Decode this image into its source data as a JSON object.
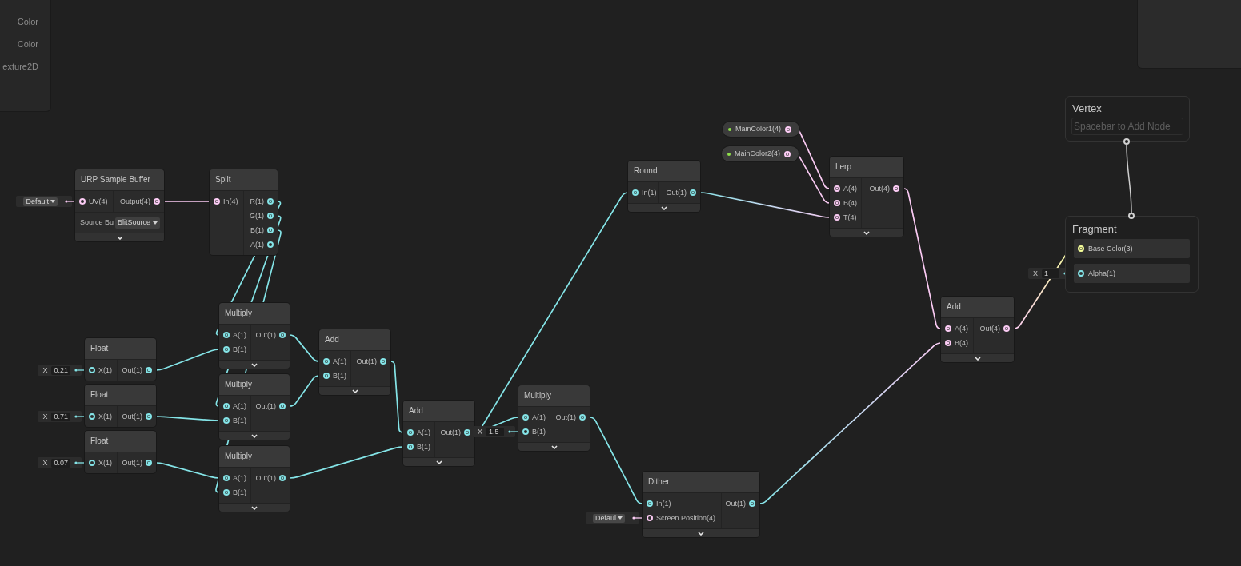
{
  "blackboard": {
    "rows": [
      {
        "type": "Color"
      },
      {
        "type": "Color"
      },
      {
        "type": "exture2D"
      }
    ]
  },
  "nodes": [
    {
      "title": "URP Sample Buffer",
      "inputs": [
        {
          "label": "UV(4)",
          "color": "#fbcbf4",
          "connected": false,
          "inline": {
            "kind": "dropdown",
            "value": "Default"
          }
        }
      ],
      "outputs": [
        {
          "label": "Output(4)",
          "color": "#fbcbf4",
          "connected": true
        }
      ],
      "settings": [
        {
          "label": "Source Bu",
          "value": "BlitSource"
        }
      ],
      "collapsed": true
    },
    {
      "title": "Split",
      "inputs": [
        {
          "label": "In(4)",
          "color": "#fbcbf4",
          "connected": true
        }
      ],
      "outputs": [
        {
          "label": "R(1)",
          "color": "#84e4e7",
          "connected": true
        },
        {
          "label": "G(1)",
          "color": "#84e4e7",
          "connected": true
        },
        {
          "label": "B(1)",
          "color": "#84e4e7",
          "connected": true
        },
        {
          "label": "A(1)",
          "color": "#84e4e7",
          "connected": false
        }
      ]
    },
    {
      "title": "Float",
      "inputs": [
        {
          "label": "X(1)",
          "color": "#84e4e7",
          "connected": false,
          "inline": {
            "kind": "float",
            "label": "X",
            "value": "0.21"
          }
        }
      ],
      "outputs": [
        {
          "label": "Out(1)",
          "color": "#84e4e7",
          "connected": true
        }
      ]
    },
    {
      "title": "Float",
      "inputs": [
        {
          "label": "X(1)",
          "color": "#84e4e7",
          "connected": false,
          "inline": {
            "kind": "float",
            "label": "X",
            "value": "0.71"
          }
        }
      ],
      "outputs": [
        {
          "label": "Out(1)",
          "color": "#84e4e7",
          "connected": true
        }
      ]
    },
    {
      "title": "Float",
      "inputs": [
        {
          "label": "X(1)",
          "color": "#84e4e7",
          "connected": false,
          "inline": {
            "kind": "float",
            "label": "X",
            "value": "0.07"
          }
        }
      ],
      "outputs": [
        {
          "label": "Out(1)",
          "color": "#84e4e7",
          "connected": true
        }
      ]
    },
    {
      "title": "Multiply",
      "inputs": [
        {
          "label": "A(1)",
          "color": "#84e4e7",
          "connected": true
        },
        {
          "label": "B(1)",
          "color": "#84e4e7",
          "connected": true
        }
      ],
      "outputs": [
        {
          "label": "Out(1)",
          "color": "#84e4e7",
          "connected": true
        }
      ],
      "collapsed": true
    },
    {
      "title": "Multiply",
      "inputs": [
        {
          "label": "A(1)",
          "color": "#84e4e7",
          "connected": true
        },
        {
          "label": "B(1)",
          "color": "#84e4e7",
          "connected": true
        }
      ],
      "outputs": [
        {
          "label": "Out(1)",
          "color": "#84e4e7",
          "connected": true
        }
      ],
      "collapsed": true
    },
    {
      "title": "Multiply",
      "inputs": [
        {
          "label": "A(1)",
          "color": "#84e4e7",
          "connected": true
        },
        {
          "label": "B(1)",
          "color": "#84e4e7",
          "connected": true
        }
      ],
      "outputs": [
        {
          "label": "Out(1)",
          "color": "#84e4e7",
          "connected": true
        }
      ],
      "collapsed": true
    },
    {
      "title": "Add",
      "inputs": [
        {
          "label": "A(1)",
          "color": "#84e4e7",
          "connected": true
        },
        {
          "label": "B(1)",
          "color": "#84e4e7",
          "connected": true
        }
      ],
      "outputs": [
        {
          "label": "Out(1)",
          "color": "#84e4e7",
          "connected": true
        }
      ],
      "collapsed": true
    },
    {
      "title": "Add",
      "inputs": [
        {
          "label": "A(1)",
          "color": "#84e4e7",
          "connected": true
        },
        {
          "label": "B(1)",
          "color": "#84e4e7",
          "connected": true
        }
      ],
      "outputs": [
        {
          "label": "Out(1)",
          "color": "#84e4e7",
          "connected": true
        }
      ],
      "collapsed": true
    },
    {
      "title": "Multiply",
      "inputs": [
        {
          "label": "A(1)",
          "color": "#84e4e7",
          "connected": true
        },
        {
          "label": "B(1)",
          "color": "#84e4e7",
          "connected": false,
          "inline": {
            "kind": "float",
            "label": "X",
            "value": "1.5"
          }
        }
      ],
      "outputs": [
        {
          "label": "Out(1)",
          "color": "#84e4e7",
          "connected": true
        }
      ],
      "collapsed": true
    },
    {
      "title": "Round",
      "inputs": [
        {
          "label": "In(1)",
          "color": "#84e4e7",
          "connected": true
        }
      ],
      "outputs": [
        {
          "label": "Out(1)",
          "color": "#84e4e7",
          "connected": true
        }
      ],
      "collapsed": true
    },
    {
      "title": "Lerp",
      "inputs": [
        {
          "label": "A(4)",
          "color": "#fbcbf4",
          "connected": true
        },
        {
          "label": "B(4)",
          "color": "#fbcbf4",
          "connected": true
        },
        {
          "label": "T(4)",
          "color": "#fbcbf4",
          "connected": true
        }
      ],
      "outputs": [
        {
          "label": "Out(4)",
          "color": "#fbcbf4",
          "connected": true
        }
      ],
      "collapsed": true
    },
    {
      "title": "Dither",
      "inputs": [
        {
          "label": "In(1)",
          "color": "#84e4e7",
          "connected": true
        },
        {
          "label": "Screen Position(4)",
          "color": "#fbcbf4",
          "connected": false,
          "inline": {
            "kind": "dropdown",
            "value": "Defaul"
          }
        }
      ],
      "outputs": [
        {
          "label": "Out(1)",
          "color": "#84e4e7",
          "connected": true
        }
      ],
      "collapsed": true
    },
    {
      "title": "Add",
      "inputs": [
        {
          "label": "A(4)",
          "color": "#fbcbf4",
          "connected": true
        },
        {
          "label": "B(4)",
          "color": "#fbcbf4",
          "connected": true
        }
      ],
      "outputs": [
        {
          "label": "Out(4)",
          "color": "#fbcbf4",
          "connected": true
        }
      ],
      "collapsed": true
    }
  ],
  "properties": [
    {
      "label": "MainColor1(4)",
      "color": "#fbcbf4",
      "connected": true
    },
    {
      "label": "MainColor2(4)",
      "color": "#fbcbf4",
      "connected": true
    }
  ],
  "contexts": [
    {
      "title": "Vertex",
      "hint": "Spacebar to Add Node"
    },
    {
      "title": "Fragment",
      "slots": [
        {
          "label": "Base Color(3)",
          "color": "#f6ff9a",
          "connected": true
        },
        {
          "label": "Alpha(1)",
          "color": "#84e4e7",
          "connected": false,
          "inline": {
            "kind": "float",
            "label": "X",
            "value": "1"
          }
        }
      ]
    }
  ]
}
